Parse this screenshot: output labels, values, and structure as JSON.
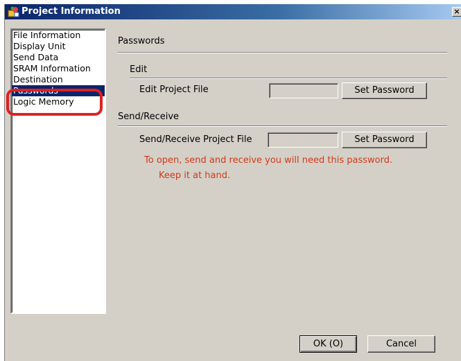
{
  "window": {
    "title": "Project Information",
    "icon": "project-info-icon",
    "close_label": "×"
  },
  "nav": {
    "items": [
      {
        "label": "File Information",
        "selected": false
      },
      {
        "label": "Display Unit",
        "selected": false
      },
      {
        "label": "Send Data",
        "selected": false
      },
      {
        "label": "SRAM Information",
        "selected": false
      },
      {
        "label": "Destination",
        "selected": false
      },
      {
        "label": "Passwords",
        "selected": true
      },
      {
        "label": "Logic Memory",
        "selected": false
      }
    ]
  },
  "panel": {
    "title": "Passwords",
    "edit": {
      "heading": "Edit",
      "field_label": "Edit Project File",
      "field_value": "",
      "button_label": "Set Password"
    },
    "send_receive": {
      "heading": "Send/Receive",
      "field_label": "Send/Receive Project File",
      "field_value": "",
      "button_label": "Set Password"
    },
    "note_line1": "To open, send and receive you will need this password.",
    "note_line2": "Keep it at hand."
  },
  "footer": {
    "ok_label": "OK (O)",
    "cancel_label": "Cancel"
  },
  "colors": {
    "title_bar": "#0a246a",
    "dialog_bg": "#d4d0c8",
    "selection": "#0a246a",
    "note_text": "#d03a18",
    "highlight_outline": "#e02020"
  }
}
